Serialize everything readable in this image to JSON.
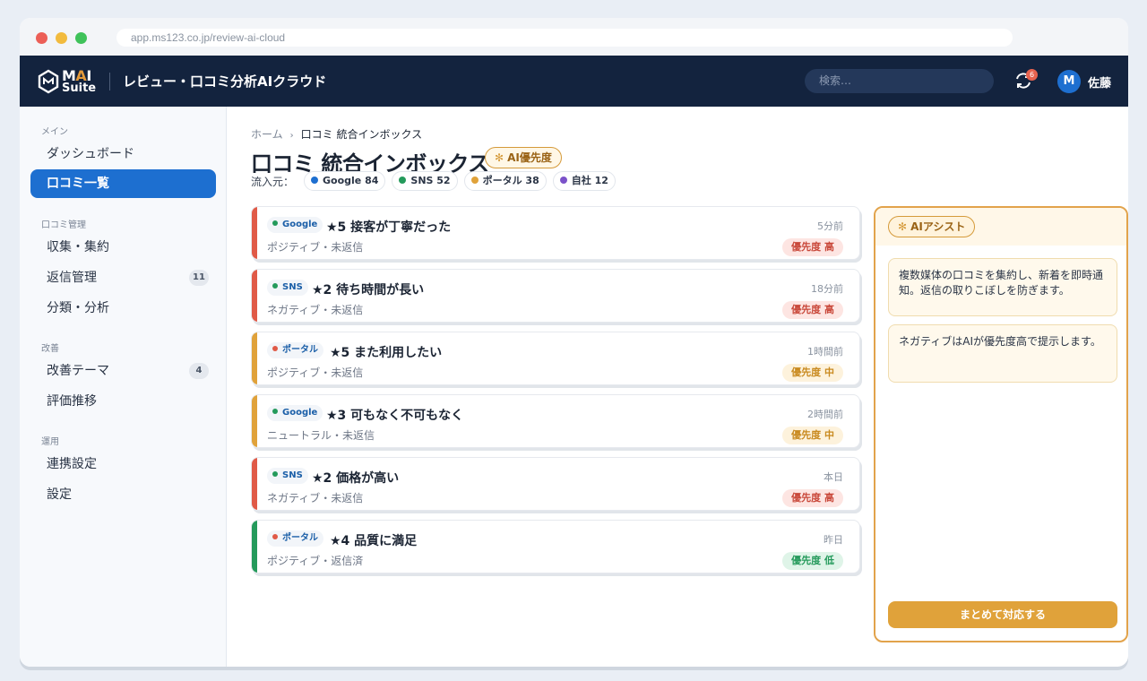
{
  "browser": {
    "url": "app.ms123.co.jp/review-ai-cloud"
  },
  "app": {
    "logo_m": "M",
    "logo_a": "A",
    "logo_i": "I",
    "logo_suite": "Suite",
    "title": "レビュー・口コミ分析AIクラウド",
    "search_placeholder": "検索…",
    "notifications": "6",
    "avatar_initial": "M",
    "user_name": "佐藤"
  },
  "sidebar": {
    "sections": [
      {
        "label": "メイン",
        "items": [
          {
            "label": "ダッシュボード"
          },
          {
            "label": "口コミ一覧",
            "active": true
          }
        ]
      },
      {
        "label": "口コミ管理",
        "items": [
          {
            "label": "収集・集約"
          },
          {
            "label": "返信管理",
            "count": "11"
          },
          {
            "label": "分類・分析"
          }
        ]
      },
      {
        "label": "改善",
        "items": [
          {
            "label": "改善テーマ",
            "count": "4"
          },
          {
            "label": "評価推移"
          }
        ]
      },
      {
        "label": "運用",
        "items": [
          {
            "label": "連携設定"
          },
          {
            "label": "設定"
          }
        ]
      }
    ]
  },
  "main": {
    "breadcrumb": {
      "home": "ホーム",
      "current": "口コミ 統合インボックス"
    },
    "title": "口コミ 統合インボックス",
    "ai_badge": "AI優先度",
    "sources_label": "流入元：",
    "sources": [
      {
        "label": "Google 84",
        "color": "#1e6fd0"
      },
      {
        "label": "SNS 52",
        "color": "#249a5b"
      },
      {
        "label": "ポータル 38",
        "color": "#e0a23a"
      },
      {
        "label": "自社 12",
        "color": "#7b52c9"
      }
    ],
    "reviews": [
      {
        "source": "Google",
        "source_color": "#249a5b",
        "title": "★5 接客が丁寧だった",
        "sub": "ポジティブ・未返信",
        "time": "5分前",
        "priority": "優先度 高",
        "level": "high",
        "bar": "#e05a47"
      },
      {
        "source": "SNS",
        "source_color": "#249a5b",
        "title": "★2 待ち時間が長い",
        "sub": "ネガティブ・未返信",
        "time": "18分前",
        "priority": "優先度 高",
        "level": "high",
        "bar": "#e05a47"
      },
      {
        "source": "ポータル",
        "source_color": "#e05a47",
        "title": "★5 また利用したい",
        "sub": "ポジティブ・未返信",
        "time": "1時間前",
        "priority": "優先度 中",
        "level": "mid",
        "bar": "#e0a23a"
      },
      {
        "source": "Google",
        "source_color": "#249a5b",
        "title": "★3 可もなく不可もなく",
        "sub": "ニュートラル・未返信",
        "time": "2時間前",
        "priority": "優先度 中",
        "level": "mid",
        "bar": "#e0a23a"
      },
      {
        "source": "SNS",
        "source_color": "#249a5b",
        "title": "★2 価格が高い",
        "sub": "ネガティブ・未返信",
        "time": "本日",
        "priority": "優先度 高",
        "level": "high",
        "bar": "#e05a47"
      },
      {
        "source": "ポータル",
        "source_color": "#e05a47",
        "title": "★4 品質に満足",
        "sub": "ポジティブ・返信済",
        "time": "昨日",
        "priority": "優先度 低",
        "level": "low",
        "bar": "#249a5b"
      }
    ]
  },
  "assist": {
    "title": "AIアシスト",
    "messages": [
      "複数媒体の口コミを集約し、新着を即時通知。返信の取りこぼしを防ぎます。",
      "ネガティブはAIが優先度高で提示します。"
    ],
    "action": "まとめて対応する"
  },
  "colors": {
    "accent": "#1d6fd0",
    "appbar": "#13233e",
    "assist_border": "#e2a34b"
  }
}
